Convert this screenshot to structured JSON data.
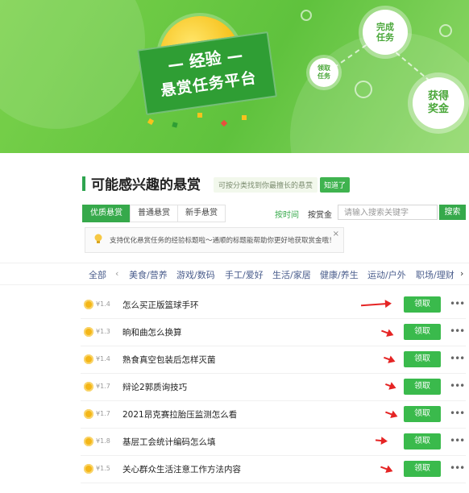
{
  "banner": {
    "title_top": "— 经验 —",
    "title_main": "悬赏任务平台",
    "steps": [
      {
        "lines": [
          "完成",
          "任务"
        ]
      },
      {
        "lines": [
          "领取",
          "任务"
        ]
      },
      {
        "lines": [
          "获得",
          "奖金"
        ]
      }
    ]
  },
  "section": {
    "title": "可能感兴趣的悬赏",
    "hint": "可按分类找到你最擅长的悬赏",
    "hint_button": "知道了"
  },
  "tabs": [
    "优质悬赏",
    "普通悬赏",
    "新手悬赏"
  ],
  "sort": {
    "time": "按时间",
    "reward": "按赏金"
  },
  "search": {
    "placeholder": "请输入搜索关键字",
    "button": "搜索"
  },
  "notice": {
    "text": "支持优化悬赏任务的经验标题啦～通顺的标题能帮助你更好地获取赏金哦！",
    "close": "×"
  },
  "categories": {
    "all": "全部",
    "prev": "‹",
    "items": [
      "美食/营养",
      "游戏/数码",
      "手工/爱好",
      "生活/家居",
      "健康/养生",
      "运动/户外",
      "职场/理财"
    ],
    "next": "›"
  },
  "tasks": [
    {
      "reward": "¥1.4",
      "title": "怎么买正版篮球手环",
      "action": "领取"
    },
    {
      "reward": "¥1.3",
      "title": "晌和曲怎么换算",
      "action": "领取"
    },
    {
      "reward": "¥1.4",
      "title": "熟食真空包装后怎样灭菌",
      "action": "领取"
    },
    {
      "reward": "¥1.7",
      "title": "辩论2郭质询技巧",
      "action": "领取"
    },
    {
      "reward": "¥1.7",
      "title": "2021昂克赛拉胎压监测怎么看",
      "action": "领取"
    },
    {
      "reward": "¥1.8",
      "title": "基层工会统计编码怎么填",
      "action": "领取"
    },
    {
      "reward": "¥1.5",
      "title": "关心群众生活注意工作方法内容",
      "action": "领取"
    }
  ],
  "more_icon": "more-dots-icon",
  "colors": {
    "accent": "#36a94b",
    "banner": "#6ec948",
    "arrow": "#e52424",
    "coin": "#f4b618"
  }
}
